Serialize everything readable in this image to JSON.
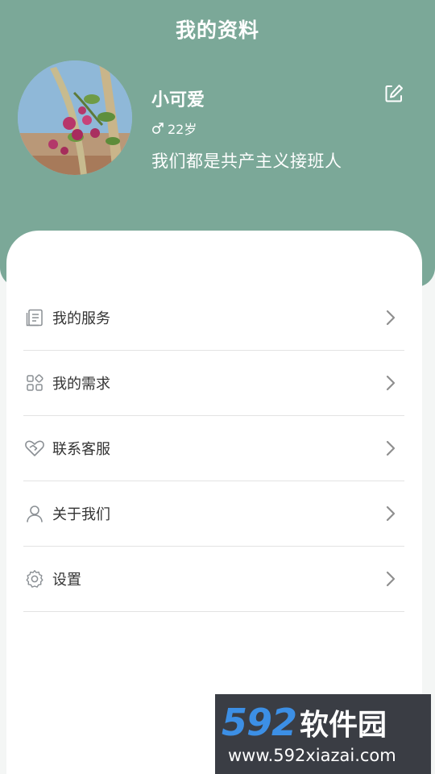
{
  "header": {
    "title": "我的资料"
  },
  "profile": {
    "name": "小可爱",
    "gender_symbol": "♂",
    "age": "22岁",
    "bio": "我们都是共产主义接班人"
  },
  "menu": {
    "items": [
      {
        "label": "我的服务",
        "icon": "document-list-icon"
      },
      {
        "label": "我的需求",
        "icon": "grid-apps-icon"
      },
      {
        "label": "联系客服",
        "icon": "heart-handshake-icon"
      },
      {
        "label": "关于我们",
        "icon": "user-icon"
      },
      {
        "label": "设置",
        "icon": "gear-icon"
      }
    ]
  },
  "watermark": {
    "number": "592",
    "text": "软件园",
    "url": "www.592xiazai.com"
  },
  "colors": {
    "header": "#7ba898",
    "text": "#333333",
    "divider": "#e3e3e3"
  }
}
